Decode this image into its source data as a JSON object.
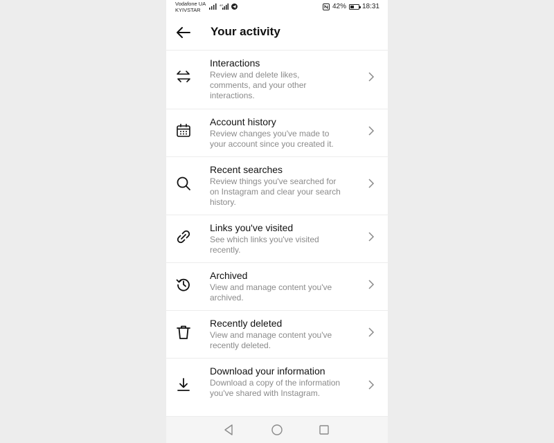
{
  "status_bar": {
    "carrier_line1": "Vodafone UA",
    "carrier_line2": "KYIVSTAR",
    "battery_percent": "42%",
    "time": "18:31",
    "battery_level": 0.42
  },
  "header": {
    "title": "Your activity",
    "back_icon": "arrow-left-icon"
  },
  "items": [
    {
      "title": "Interactions",
      "desc": "Review and delete likes, comments, and your other interactions.",
      "icon": "interactions-icon"
    },
    {
      "title": "Account history",
      "desc": "Review changes you've made to your account since you created it.",
      "icon": "calendar-icon"
    },
    {
      "title": "Recent searches",
      "desc": "Review things you've searched for on Instagram and clear your search history.",
      "icon": "search-icon"
    },
    {
      "title": "Links you've visited",
      "desc": "See which links you've visited recently.",
      "icon": "link-icon"
    },
    {
      "title": "Archived",
      "desc": "View and manage content you've archived.",
      "icon": "archive-history-icon"
    },
    {
      "title": "Recently deleted",
      "desc": "View and manage content you've recently deleted.",
      "icon": "trash-icon"
    },
    {
      "title": "Download your information",
      "desc": "Download a copy of the information you've shared with Instagram.",
      "icon": "download-icon"
    }
  ],
  "nav": {
    "back": "nav-back-icon",
    "home": "nav-home-icon",
    "recents": "nav-recents-icon"
  }
}
